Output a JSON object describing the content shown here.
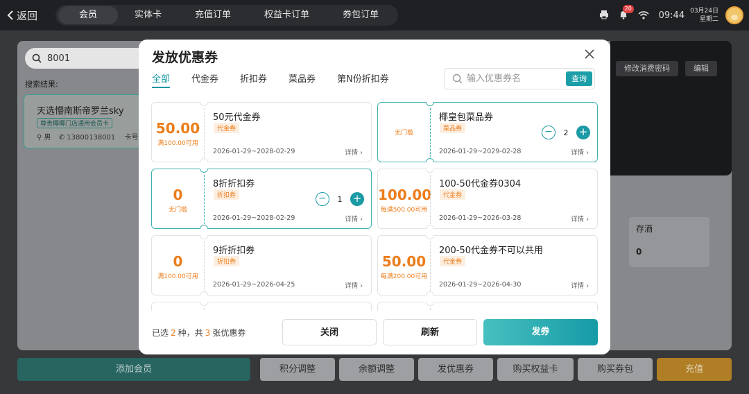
{
  "topbar": {
    "back_label": "返回",
    "tabs": [
      "会员",
      "实体卡",
      "充值订单",
      "权益卡订单",
      "券包订单"
    ],
    "notification_count": "20",
    "time": "09:44",
    "date_line1": "03月24日",
    "date_line2": "星期二"
  },
  "background": {
    "search_value": "8001",
    "search_result_label": "搜索结果:",
    "member_name": "天选懵南斯帝罗兰sky",
    "member_tag": "尊贵椰椰门店通用会员卡",
    "member_gender": "男",
    "member_phone": "13800138001",
    "member_card_label": "卡号",
    "btn_change_password": "修改消费密码",
    "btn_edit": "编辑",
    "wine_label": "存酒",
    "wine_value": "0",
    "bottom_buttons": [
      "添加会员",
      "积分调整",
      "余额调整",
      "发优惠券",
      "购买权益卡",
      "购买券包",
      "充值"
    ]
  },
  "modal": {
    "title": "发放优惠券",
    "tabs": [
      "全部",
      "代金券",
      "折扣券",
      "菜品券",
      "第N份折扣券"
    ],
    "active_tab": "全部",
    "search_placeholder": "输入优惠券名",
    "search_button": "查询",
    "detail_label": "详情",
    "coupons": [
      {
        "amount": "50.00",
        "condition": "满100.00可用",
        "name": "50元代金券",
        "type": "代金券",
        "validity": "2026-01-29~2028-02-29",
        "selected": false
      },
      {
        "amount": "",
        "condition": "无门槛",
        "name": "椰皇包菜品券",
        "type": "菜品券",
        "validity": "2026-01-29~2029-02-28",
        "selected": true,
        "quantity": "2"
      },
      {
        "amount": "0",
        "condition": "无门槛",
        "name": "8折折扣券",
        "type": "折扣券",
        "validity": "2026-01-29~2028-02-29",
        "selected": true,
        "quantity": "1"
      },
      {
        "amount": "100.00",
        "condition": "每满500.00可用",
        "name": "100-50代金券0304",
        "type": "代金券",
        "validity": "2026-01-29~2026-03-28",
        "selected": false
      },
      {
        "amount": "0",
        "condition": "满100.00可用",
        "name": "9折折扣券",
        "type": "折扣券",
        "validity": "2026-01-29~2026-04-25",
        "selected": false
      },
      {
        "amount": "50.00",
        "condition": "每满200.00可用",
        "name": "200-50代金券不可以共用",
        "type": "代金券",
        "validity": "2026-01-29~2026-04-30",
        "selected": false
      }
    ],
    "summary": {
      "prefix": "已选",
      "kinds": "2",
      "mid": "种，共",
      "count": "3",
      "suffix": "张优惠券"
    },
    "buttons": {
      "close": "关闭",
      "refresh": "刷新",
      "issue": "发券"
    }
  },
  "colors": {
    "accent": "#1797a0",
    "orange": "#ec7d1b",
    "primary_btn": "#169ba6"
  }
}
